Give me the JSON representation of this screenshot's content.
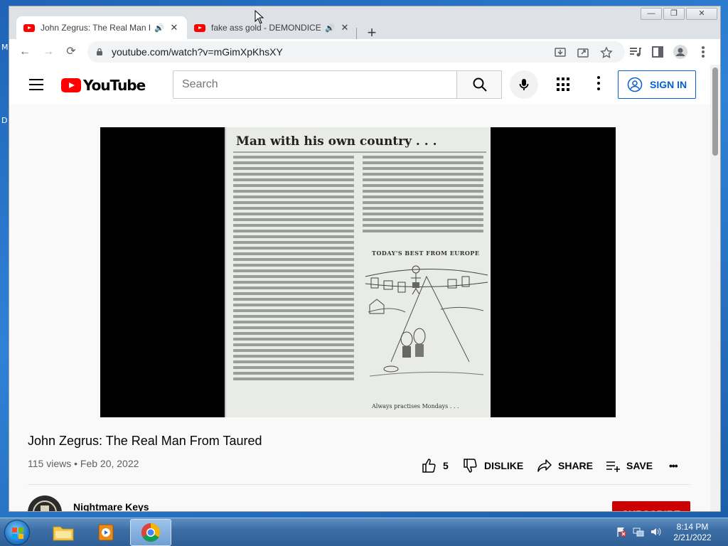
{
  "desktop": {
    "edge_text_1": "Ma",
    "edge_text_2": "D"
  },
  "window": {
    "minimize": "—",
    "maximize": "❐",
    "close": "✕"
  },
  "tabs": [
    {
      "title": "John Zegrus: The Real Man F",
      "sound": "🔊",
      "close": "✕",
      "active": true
    },
    {
      "title": "fake ass gold - DEMONDICE",
      "sound": "🔊",
      "close": "✕",
      "active": false
    }
  ],
  "new_tab_label": "+",
  "toolbar": {
    "back": "←",
    "forward": "→",
    "reload": "⟳",
    "url": "youtube.com/watch?v=mGimXpKhsXY"
  },
  "youtube": {
    "logo_text": "YouTube",
    "search_placeholder": "Search",
    "sign_in": "SIGN IN"
  },
  "player": {
    "clipping_title": "Man with his own country . . .",
    "clipping_subhead": "TODAY'S BEST FROM EUROPE",
    "clipping_caption": "Always practises Mondays . . ."
  },
  "video": {
    "title": "John Zegrus: The Real Man From Taured",
    "views": "115 views",
    "separator": "•",
    "date": "Feb 20, 2022",
    "likes": "5",
    "dislike": "DISLIKE",
    "share": "SHARE",
    "save": "SAVE",
    "more": "•••"
  },
  "channel": {
    "name": "Nightmare Keys",
    "subscribe": "SUBSCRIBE"
  },
  "taskbar": {
    "time": "8:14 PM",
    "date": "2/21/2022"
  },
  "colors": {
    "youtube_red": "#ff0000",
    "signin_blue": "#065fd4",
    "subscribe_red": "#cc0000"
  }
}
